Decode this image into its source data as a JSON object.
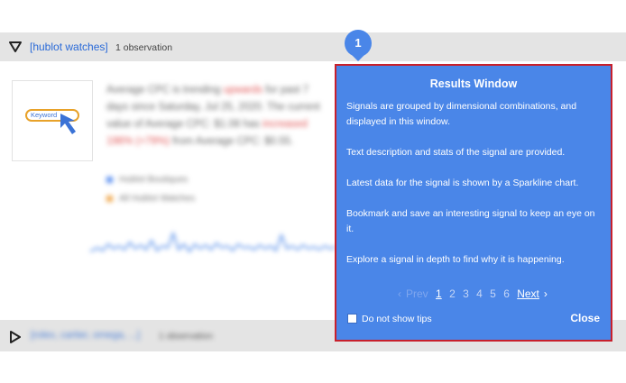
{
  "group": {
    "query": "[hublot watches]",
    "count": "1 observation"
  },
  "card": {
    "thumb_keyword": "Keyword",
    "desc_parts": [
      "Average CPC ",
      "is trending ",
      "upwards",
      " for past 7 days since Saturday, Jul 25, 2020. The current value of ",
      "Average CPC: $1.08",
      " has ",
      "increased 196% (+79%)",
      " from Average CPC: $0.55."
    ],
    "legend": [
      "Hublot Boutiques",
      "All Hublot Watches"
    ],
    "colors": {
      "legend1": "#5b8ff0",
      "legend2": "#f0a84e",
      "sparkline": "#4a86e8"
    }
  },
  "group2": {
    "query": "[rolex, cartier, omega, ...]",
    "count": "1 observation"
  },
  "badge": "1",
  "tip": {
    "title": "Results Window",
    "paragraphs": [
      "Signals are grouped by dimensional combinations, and displayed in this window.",
      "Text description and stats of the signal are provided.",
      "Latest data for the signal is shown by a Sparkline chart.",
      "Bookmark and save an interesting signal to keep an eye on it.",
      "Explore a signal in depth to find why it is happening."
    ],
    "pager": {
      "prev": "Prev",
      "pages": [
        "1",
        "2",
        "3",
        "4",
        "5",
        "6"
      ],
      "current": "1",
      "next": "Next"
    },
    "checkbox_label": "Do not show tips",
    "close": "Close"
  },
  "colors": {
    "accent": "#4a86e8",
    "outline": "#c8202c",
    "group_bar": "#e4e4e4"
  }
}
